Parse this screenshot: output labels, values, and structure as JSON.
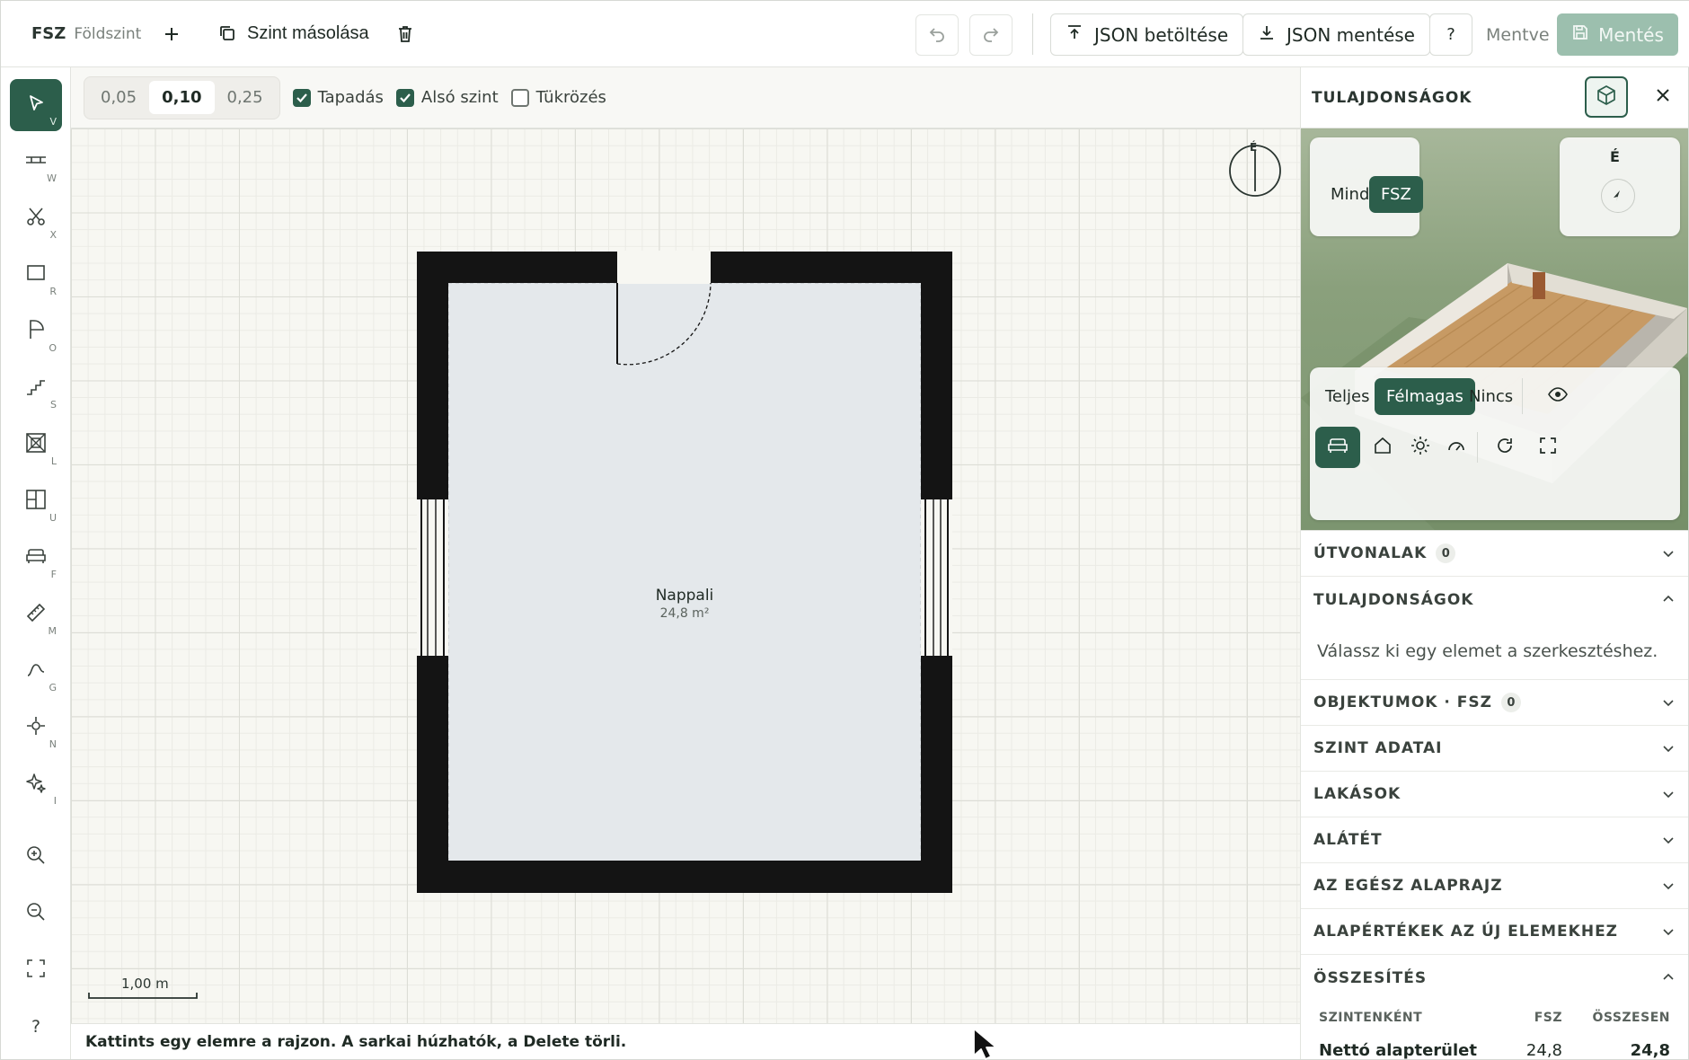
{
  "topbar": {
    "level_code": "FSZ",
    "level_name": "Földszint",
    "add_icon": "plus-icon",
    "copy_level_label": "Szint másolása",
    "delete_icon": "trash-icon",
    "undo_icon": "undo-icon",
    "redo_icon": "redo-icon",
    "load_json_label": "JSON betöltése",
    "save_json_label": "JSON mentése",
    "help_label": "?",
    "saved_status": "Mentve",
    "save_label": "Mentés"
  },
  "tools": [
    {
      "name": "select",
      "key": "V",
      "icon": "pointer-icon",
      "active": true
    },
    {
      "name": "wall",
      "key": "W",
      "icon": "wall-icon",
      "active": false
    },
    {
      "name": "cut",
      "key": "X",
      "icon": "scissors-icon",
      "active": false
    },
    {
      "name": "room",
      "key": "R",
      "icon": "rectangle-icon",
      "active": false
    },
    {
      "name": "opening",
      "key": "O",
      "icon": "door-icon",
      "active": false
    },
    {
      "name": "stairs",
      "key": "S",
      "icon": "stairs-icon",
      "active": false
    },
    {
      "name": "window",
      "key": "L",
      "icon": "window-icon",
      "active": false
    },
    {
      "name": "unit",
      "key": "U",
      "icon": "layout-icon",
      "active": false
    },
    {
      "name": "furniture",
      "key": "F",
      "icon": "sofa-icon",
      "active": false
    },
    {
      "name": "measure",
      "key": "M",
      "icon": "ruler-icon",
      "active": false
    },
    {
      "name": "curve",
      "key": "G",
      "icon": "curve-icon",
      "active": false
    },
    {
      "name": "node",
      "key": "N",
      "icon": "node-icon",
      "active": false
    },
    {
      "name": "ai",
      "key": "I",
      "icon": "sparkle-icon",
      "active": false
    }
  ],
  "zoom_tools": {
    "zoom_in": "zoom-in-icon",
    "zoom_out": "zoom-out-icon",
    "fit": "fit-screen-icon",
    "help": "?"
  },
  "canvas_bar": {
    "grid_steps": [
      "0,05",
      "0,10",
      "0,25"
    ],
    "grid_selected": "0,10",
    "snap_label": "Tapadás",
    "snap_checked": true,
    "lower_level_label": "Alsó szint",
    "lower_level_checked": true,
    "mirror_label": "Tükrözés",
    "mirror_checked": false
  },
  "plan": {
    "room_name": "Nappali",
    "room_area": "24,8 m²",
    "compass_label": "É",
    "scale_label": "1,00 m"
  },
  "status_bar": "Kattints egy elemre a rajzon. A sarkai húzhatók, a Delete törli.",
  "panel": {
    "title": "TULAJDONSÁGOK",
    "view_levels": {
      "all": "Mind",
      "level": "FSZ"
    },
    "north_label": "É",
    "wall_modes": [
      "Teljes",
      "Félmagas",
      "Nincs"
    ],
    "wall_mode_selected": "Félmagas",
    "sections": [
      {
        "title": "ÚTVONALAK",
        "badge": "0",
        "open": false
      },
      {
        "title": "TULAJDONSÁGOK",
        "badge": "",
        "open": true,
        "body": "Válassz ki egy elemet a szerkesztéshez."
      },
      {
        "title": "OBJEKTUMOK · FSZ",
        "badge": "0",
        "open": false
      },
      {
        "title": "SZINT ADATAI",
        "badge": "",
        "open": false
      },
      {
        "title": "LAKÁSOK",
        "badge": "",
        "open": false
      },
      {
        "title": "ALÁTÉT",
        "badge": "",
        "open": false
      },
      {
        "title": "AZ EGÉSZ ALAPRAJZ",
        "badge": "",
        "open": false
      },
      {
        "title": "ALAPÉRTÉKEK AZ ÚJ ELEMEKHEZ",
        "badge": "",
        "open": false
      },
      {
        "title": "ÖSSZESÍTÉS",
        "badge": "",
        "open": true
      }
    ],
    "summary": {
      "headers": [
        "SZINTENKÉNT",
        "FSZ",
        "ÖSSZESEN"
      ],
      "rows": [
        {
          "label": "Nettó alapterület",
          "fsz": "24,8",
          "total": "24,8"
        }
      ]
    }
  }
}
